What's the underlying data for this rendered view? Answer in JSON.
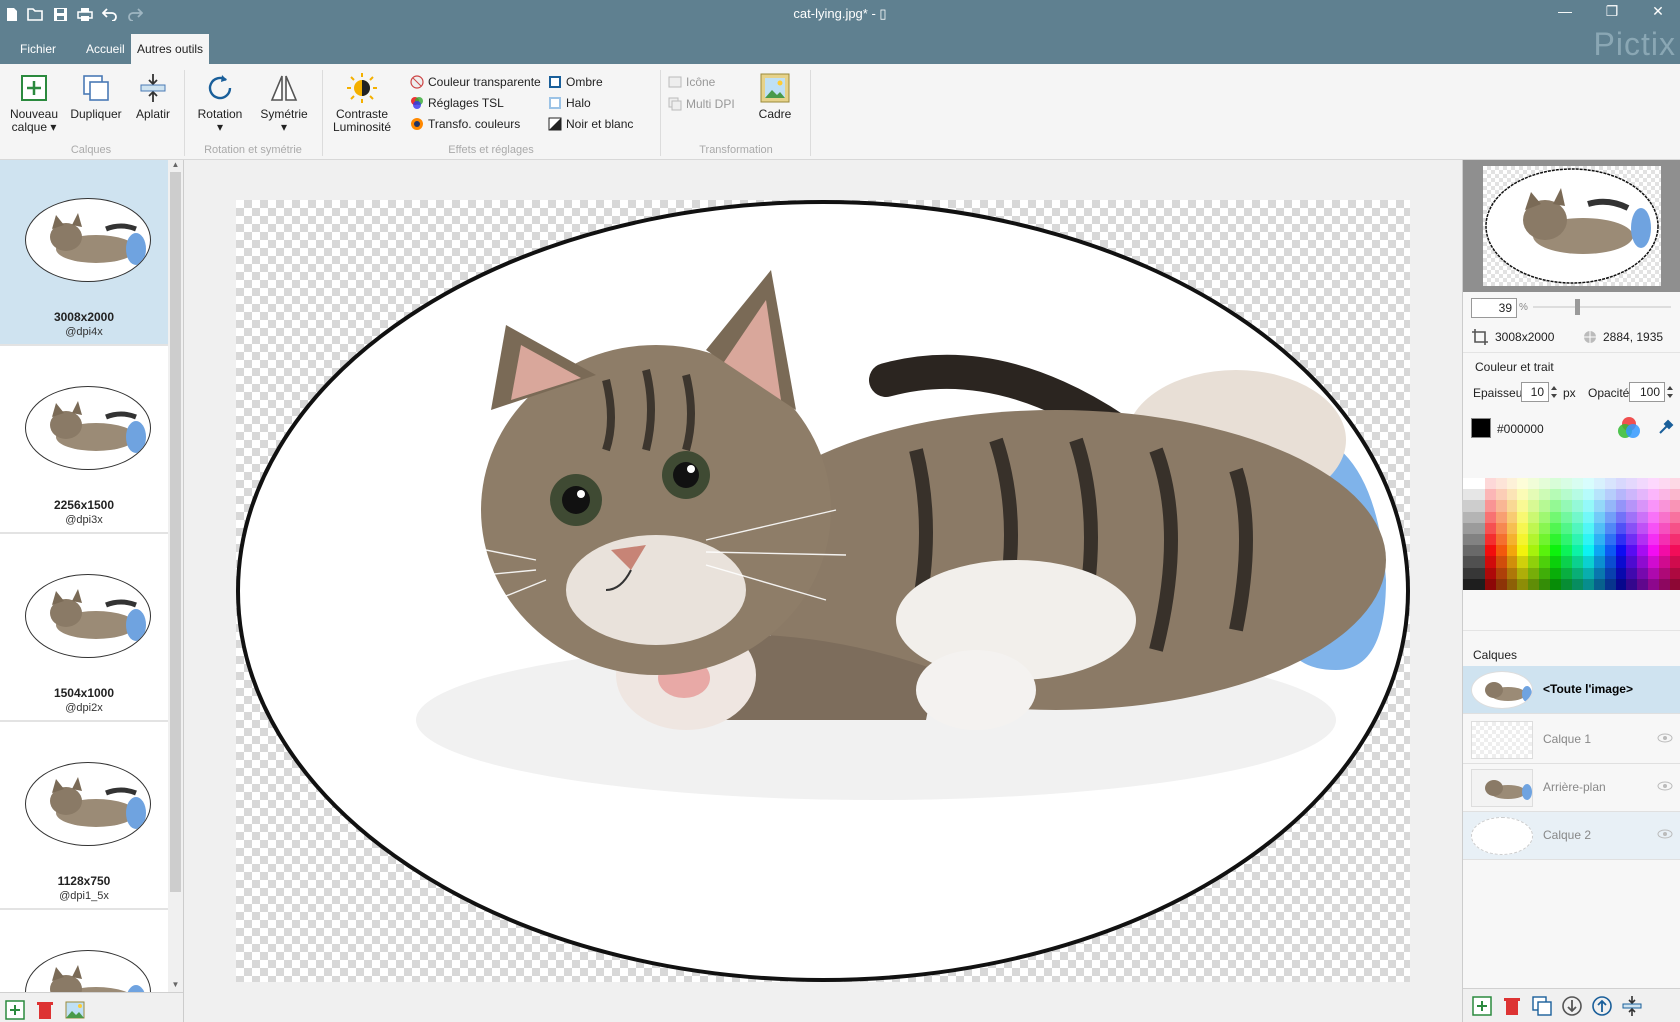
{
  "window": {
    "title": "cat-lying.jpg* - ▯",
    "brand": "Pictix",
    "min_glyph": "—",
    "max_glyph": "❐",
    "close_glyph": "✕"
  },
  "tabs": [
    {
      "label": "Fichier"
    },
    {
      "label": "Accueil"
    },
    {
      "label": "Autres outils"
    }
  ],
  "ribbon": {
    "calques": {
      "group_label": "Calques",
      "new_layer_line1": "Nouveau",
      "new_layer_line2": "calque ▾",
      "duplicate": "Dupliquer",
      "flatten": "Aplatir"
    },
    "rotation": {
      "group_label": "Rotation et symétrie",
      "rotation": "Rotation",
      "symmetry": "Symétrie",
      "arrow": "▾"
    },
    "effects": {
      "group_label": "Effets et réglages",
      "contrast_line1": "Contraste",
      "contrast_line2": "Luminosité",
      "transparent_color": "Couleur transparente",
      "hsl": "Réglages TSL",
      "color_transform": "Transfo. couleurs",
      "shadow": "Ombre",
      "halo": "Halo",
      "bw": "Noir et blanc"
    },
    "transformation": {
      "group_label": "Transformation",
      "icon": "Icône",
      "multidpi": "Multi DPI",
      "frame": "Cadre"
    }
  },
  "variants": [
    {
      "size": "3008x2000",
      "dpi": "@dpi4x",
      "selected": true
    },
    {
      "size": "2256x1500",
      "dpi": "@dpi3x",
      "selected": false
    },
    {
      "size": "1504x1000",
      "dpi": "@dpi2x",
      "selected": false
    },
    {
      "size": "1128x750",
      "dpi": "@dpi1_5x",
      "selected": false
    }
  ],
  "scroll": {
    "up": "▲",
    "down": "▼"
  },
  "props": {
    "zoom": "39",
    "zoom_unit": "%",
    "image_size": "3008x2000",
    "cursor_pos": "2884, 1935",
    "section_color": "Couleur et trait",
    "thickness_label": "Epaisseur",
    "thickness": "10",
    "thickness_unit": "px",
    "opacity_label": "Opacité",
    "opacity": "100",
    "color_hex": "#000000"
  },
  "layers": {
    "title": "Calques",
    "items": [
      {
        "name": "<Toute l'image>"
      },
      {
        "name": "Calque 1"
      },
      {
        "name": "Arrière-plan"
      },
      {
        "name": "Calque 2"
      }
    ]
  },
  "colors": {
    "titlebar": "#5f8090",
    "selection": "#cfe3f0",
    "accent": "#1a5f9a"
  }
}
